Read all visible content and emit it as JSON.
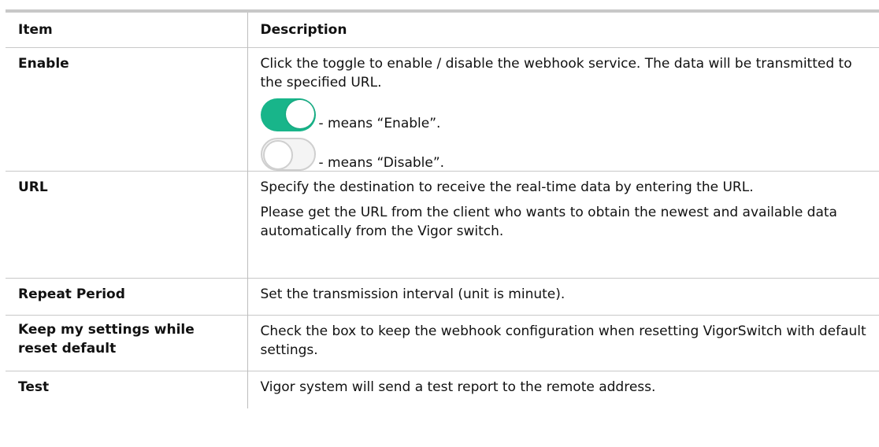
{
  "table": {
    "headers": [
      "Item",
      "Description"
    ],
    "rows": [
      {
        "item": "Enable",
        "desc": [
          "Click the toggle to enable / disable the webhook service. The data will be transmitted to the specified URL."
        ],
        "toggles": [
          {
            "state": "on",
            "color": "#18b58a",
            "caption": "- means “Enable”."
          },
          {
            "state": "off",
            "color": "#cfcfcf",
            "caption": "- means “Disable”."
          }
        ]
      },
      {
        "item": "URL",
        "desc": [
          "Specify the destination to receive the real-time data by entering the URL.",
          "Please get the URL from the client who wants to obtain the newest and available data automatically from the Vigor switch."
        ]
      },
      {
        "item": "Repeat Period",
        "desc": [
          "Set the transmission interval (unit is minute)."
        ]
      },
      {
        "item": "Keep my settings while reset default",
        "desc": [
          "Check the box to keep the webhook configuration when resetting VigorSwitch with default settings."
        ]
      },
      {
        "item": "Test",
        "desc": [
          "Vigor system will send a test report to the remote address."
        ]
      }
    ]
  }
}
